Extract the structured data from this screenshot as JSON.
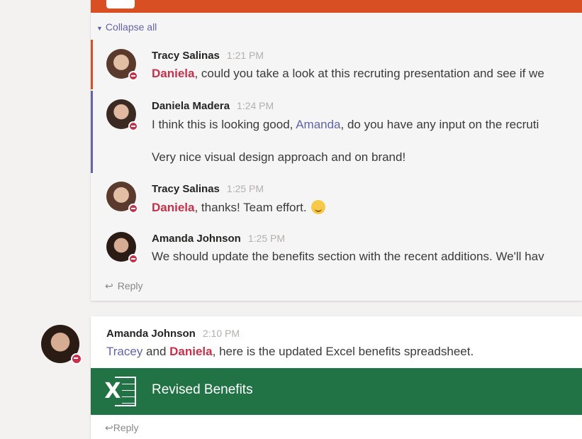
{
  "thread": {
    "collapse_label": "Collapse all",
    "messages": [
      {
        "author": "Tracy Salinas",
        "time": "1:21 PM",
        "mention": "Daniela",
        "text": ", could you take a look at this recruting presentation and see if we",
        "accent_color": "#d94f24"
      },
      {
        "author": "Daniela Madera",
        "time": "1:24 PM",
        "text_before": "I think this is looking good, ",
        "mention": "Amanda",
        "text_after": ", do you have any input on the recruti",
        "second_line": "Very nice visual design approach and on brand!",
        "accent_color": "#6264a7"
      },
      {
        "author": "Tracy Salinas",
        "time": "1:25 PM",
        "mention": "Daniela",
        "text": ", thanks! Team effort."
      },
      {
        "author": "Amanda Johnson",
        "time": "1:25 PM",
        "text": "We should update the benefits section with the recent additions. We'll hav"
      }
    ],
    "reply_label": "Reply"
  },
  "post": {
    "author": "Amanda Johnson",
    "time": "2:10 PM",
    "mention1": "Tracey",
    "between": " and ",
    "mention2": "Daniela",
    "text": ", here is the updated Excel benefits spreadsheet.",
    "attachment_title": "Revised Benefits",
    "attachment_icon_letter": "X",
    "reply_label": "Reply"
  },
  "colors": {
    "presentation_banner": "#d94f24",
    "excel_green": "#217346",
    "mention_red": "#c4314b",
    "mention_blue": "#6264a7"
  },
  "icons": [
    "chevron-down-icon",
    "busy-status-icon",
    "reply-arrow-icon",
    "excel-icon",
    "wink-emoji-icon"
  ]
}
